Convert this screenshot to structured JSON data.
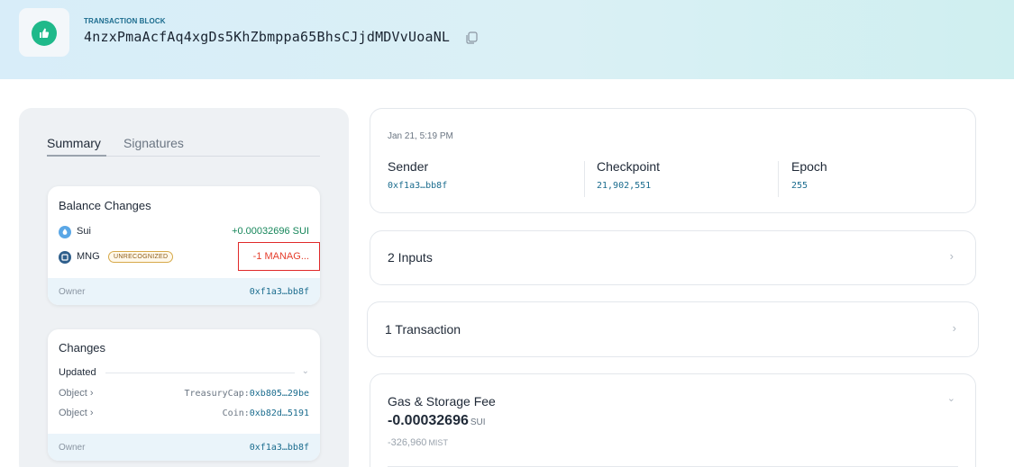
{
  "header": {
    "kind_label": "TRANSACTION BLOCK",
    "digest": "4nzxPmaAcfAq4xgDs5KhZbmppa65BhsCJjdMDVvUoaNL",
    "accent_color": "#1fb98a"
  },
  "tabs": {
    "summary": "Summary",
    "signatures": "Signatures"
  },
  "balance_changes": {
    "title": "Balance Changes",
    "rows": [
      {
        "coin": "Sui",
        "amount": "+0.00032696 SUI",
        "icon": "sui-coin-icon"
      },
      {
        "coin": "MNG",
        "badge": "UNRECOGNIZED",
        "amount": "-1 MANAG...",
        "icon": "coin-icon"
      }
    ],
    "owner_label": "Owner",
    "owner_value": "0xf1a3…bb8f"
  },
  "changes": {
    "title": "Changes",
    "updated_label": "Updated",
    "objects": [
      {
        "label": "Object ›",
        "type": "TreasuryCap:",
        "id": "0xb805…29be"
      },
      {
        "label": "Object ›",
        "type": "Coin:",
        "id": "0xb82d…5191"
      }
    ],
    "owner_label": "Owner",
    "owner_value": "0xf1a3…bb8f"
  },
  "meta": {
    "date": "Jan 21, 5:19 PM",
    "sender_label": "Sender",
    "sender_value": "0xf1a3…bb8f",
    "checkpoint_label": "Checkpoint",
    "checkpoint_value": "21,902,551",
    "epoch_label": "Epoch",
    "epoch_value": "255"
  },
  "inputs": {
    "title": "2 Inputs"
  },
  "transactions": {
    "title": "1 Transaction"
  },
  "gas": {
    "title": "Gas & Storage Fee",
    "amount": "-0.00032696",
    "unit": "SUI",
    "mist": "-326,960",
    "mist_unit": "MIST"
  }
}
